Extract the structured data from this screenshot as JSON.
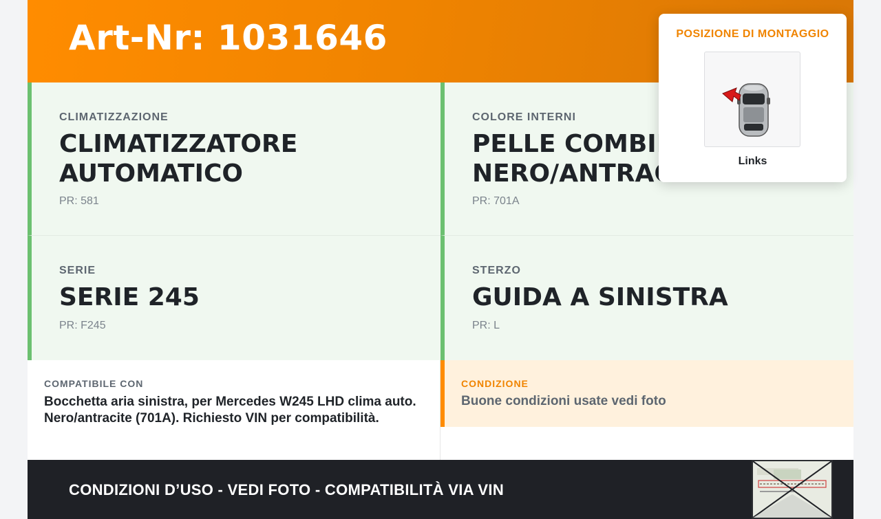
{
  "header": {
    "title": "Art-Nr: 1031646"
  },
  "specs": [
    {
      "label": "CLIMATIZZAZIONE",
      "value": "CLIMATIZZATORE AUTOMATICO",
      "pr": "PR: 581"
    },
    {
      "label": "COLORE INTERNI",
      "value": "PELLE COMBINATA NERO/ANTRACITE",
      "pr": "PR: 701A"
    },
    {
      "label": "SERIE",
      "value": "SERIE 245",
      "pr": "PR: F245"
    },
    {
      "label": "STERZO",
      "value": "GUIDA A SINISTRA",
      "pr": "PR: L"
    }
  ],
  "compat": {
    "label": "COMPATIBILE CON",
    "text": "Bocchetta aria sinistra, per Mercedes W245 LHD clima auto. Nero/antracite (701A). Richiesto VIN per compatibilità."
  },
  "condition": {
    "label": "CONDIZIONE",
    "text": "Buone condizioni usate vedi foto"
  },
  "position": {
    "title": "POSIZIONE DI MONTAGGIO",
    "caption": "Links"
  },
  "footer": {
    "text": "CONDIZIONI D’USO - VEDI FOTO - COMPATIBILITÀ VIA VIN"
  },
  "colors": {
    "accent": "#ff8c00",
    "spec_border": "#6cc070",
    "footer_bg": "#1f2126"
  }
}
